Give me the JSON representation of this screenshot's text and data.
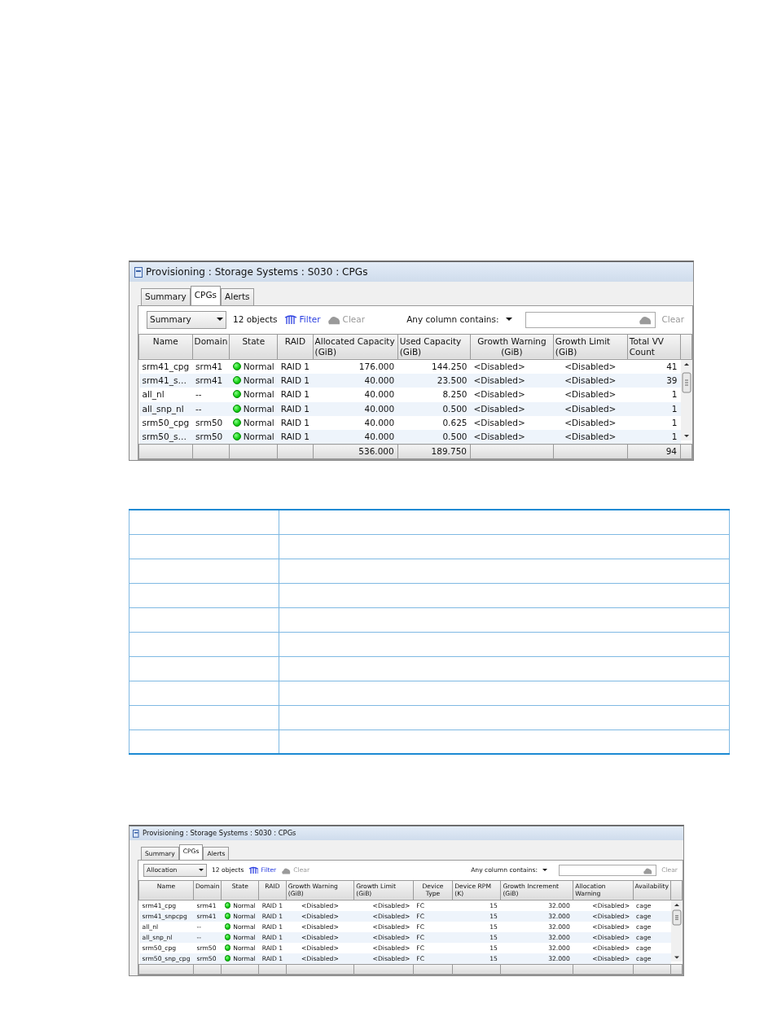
{
  "windows": [
    {
      "title": "Provisioning : Storage Systems : S030 : CPGs",
      "tabs": [
        {
          "label": "Summary",
          "selected": false
        },
        {
          "label": "CPGs",
          "selected": true
        },
        {
          "label": "Alerts",
          "selected": false
        }
      ],
      "view_select": "Summary",
      "object_count": "12 objects",
      "filter": {
        "label": "Filter",
        "disabled": false
      },
      "clear": {
        "label": "Clear",
        "disabled": true
      },
      "search_label": "Any column contains:",
      "search_clear": {
        "label": "Clear",
        "disabled": true
      },
      "columns": [
        {
          "label": "Name",
          "kind": "text"
        },
        {
          "label": "Domain",
          "kind": "text"
        },
        {
          "label": "State",
          "kind": "state"
        },
        {
          "label": "RAID",
          "kind": "text"
        },
        {
          "label": "Allocated Capacity (GiB)",
          "kind": "number",
          "total": "536.000"
        },
        {
          "label": "Used Capacity (GiB)",
          "kind": "number",
          "total": "189.750"
        },
        {
          "label": "Growth Warning (GiB)",
          "kind": "text"
        },
        {
          "label": "Growth Limit (GiB)",
          "kind": "center"
        },
        {
          "label": "Total VV Count",
          "kind": "number",
          "total": "94"
        }
      ],
      "rows": [
        [
          "srm41_cpg",
          "srm41",
          "Normal",
          "RAID 1",
          "176.000",
          "144.250",
          "<Disabled>",
          "<Disabled>",
          "41"
        ],
        [
          "srm41_s…",
          "srm41",
          "Normal",
          "RAID 1",
          "40.000",
          "23.500",
          "<Disabled>",
          "<Disabled>",
          "39"
        ],
        [
          "all_nl",
          "--",
          "Normal",
          "RAID 1",
          "40.000",
          "8.250",
          "<Disabled>",
          "<Disabled>",
          "1"
        ],
        [
          "all_snp_nl",
          "--",
          "Normal",
          "RAID 1",
          "40.000",
          "0.500",
          "<Disabled>",
          "<Disabled>",
          "1"
        ],
        [
          "srm50_cpg",
          "srm50",
          "Normal",
          "RAID 1",
          "40.000",
          "0.625",
          "<Disabled>",
          "<Disabled>",
          "1"
        ],
        [
          "srm50_s…",
          "srm50",
          "Normal",
          "RAID 1",
          "40.000",
          "0.500",
          "<Disabled>",
          "<Disabled>",
          "1"
        ]
      ]
    },
    {
      "title": "Provisioning : Storage Systems : S030 : CPGs",
      "tabs": [
        {
          "label": "Summary",
          "selected": false
        },
        {
          "label": "CPGs",
          "selected": true
        },
        {
          "label": "Alerts",
          "selected": false
        }
      ],
      "view_select": "Allocation",
      "object_count": "12 objects",
      "filter": {
        "label": "Filter",
        "disabled": false
      },
      "clear": {
        "label": "Clear",
        "disabled": true
      },
      "search_label": "Any column contains:",
      "search_clear": {
        "label": "Clear",
        "disabled": true
      },
      "columns": [
        {
          "label": "Name",
          "kind": "text"
        },
        {
          "label": "Domain",
          "kind": "text"
        },
        {
          "label": "State",
          "kind": "state"
        },
        {
          "label": "RAID",
          "kind": "text"
        },
        {
          "label": "Growth Warning (GiB)",
          "kind": "center"
        },
        {
          "label": "Growth Limit (GiB)",
          "kind": "right"
        },
        {
          "label": "Device Type",
          "kind": "text"
        },
        {
          "label": "Device RPM (K)",
          "kind": "number"
        },
        {
          "label": "Growth Increment (GiB)",
          "kind": "number"
        },
        {
          "label": "Allocation Warning",
          "kind": "right"
        },
        {
          "label": "Availability",
          "kind": "text"
        }
      ],
      "rows": [
        [
          "srm41_cpg",
          "srm41",
          "Normal",
          "RAID 1",
          "<Disabled>",
          "<Disabled>",
          "FC",
          "15",
          "32.000",
          "<Disabled>",
          "cage"
        ],
        [
          "srm41_snpcpg",
          "srm41",
          "Normal",
          "RAID 1",
          "<Disabled>",
          "<Disabled>",
          "FC",
          "15",
          "32.000",
          "<Disabled>",
          "cage"
        ],
        [
          "all_nl",
          "--",
          "Normal",
          "RAID 1",
          "<Disabled>",
          "<Disabled>",
          "FC",
          "15",
          "32.000",
          "<Disabled>",
          "cage"
        ],
        [
          "all_snp_nl",
          "--",
          "Normal",
          "RAID 1",
          "<Disabled>",
          "<Disabled>",
          "FC",
          "15",
          "32.000",
          "<Disabled>",
          "cage"
        ],
        [
          "srm50_cpg",
          "srm50",
          "Normal",
          "RAID 1",
          "<Disabled>",
          "<Disabled>",
          "FC",
          "15",
          "32.000",
          "<Disabled>",
          "cage"
        ],
        [
          "srm50_snp_cpg",
          "srm50",
          "Normal",
          "RAID 1",
          "<Disabled>",
          "<Disabled>",
          "FC",
          "15",
          "32.000",
          "<Disabled>",
          "cage"
        ]
      ]
    }
  ]
}
